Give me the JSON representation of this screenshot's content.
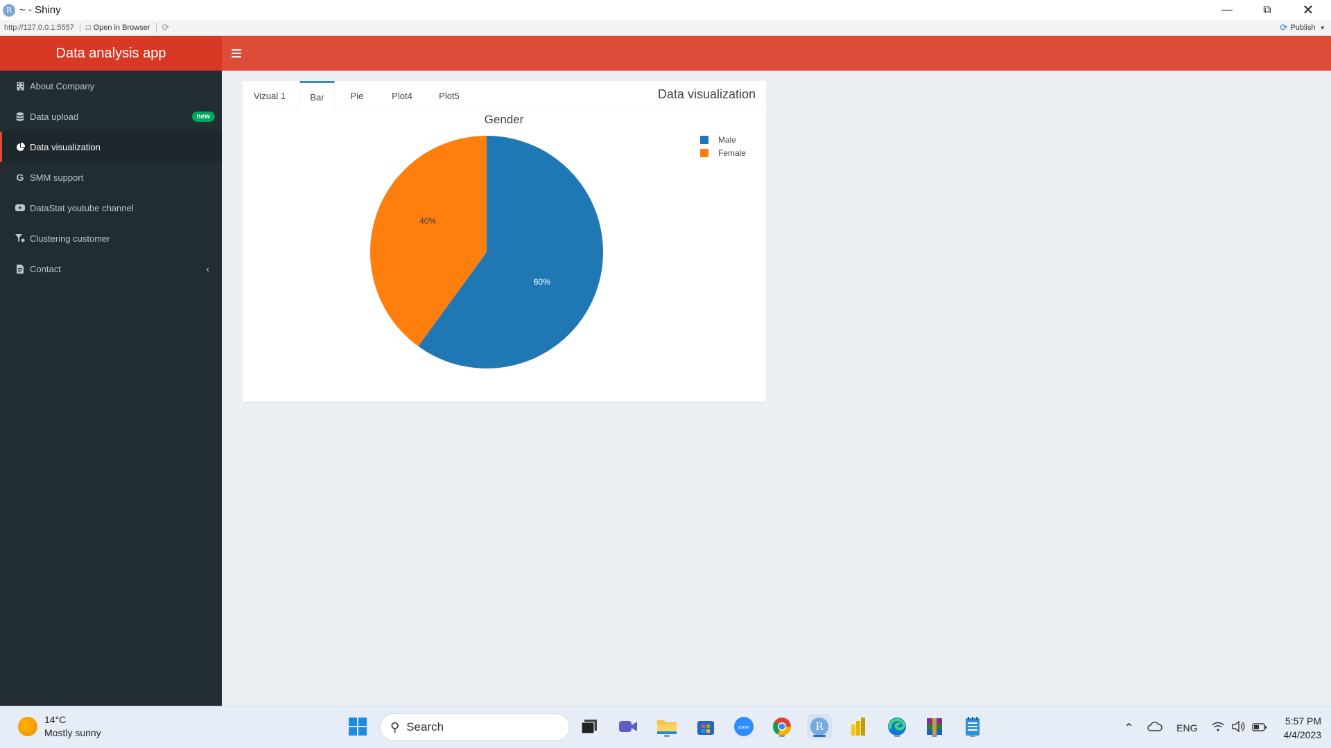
{
  "window": {
    "title": "~ - Shiny",
    "r_logo": "R"
  },
  "addressbar": {
    "url": "http://127.0.0.1:5557",
    "open_in_browser": "Open in Browser",
    "publish": "Publish"
  },
  "app": {
    "logo": "Data analysis app"
  },
  "sidebar": {
    "items": [
      {
        "label": "About Company",
        "icon": "building-icon"
      },
      {
        "label": "Data upload",
        "icon": "database-icon",
        "badge": "new"
      },
      {
        "label": "Data visualization",
        "icon": "pie-chart-icon",
        "active": true
      },
      {
        "label": "SMM support",
        "icon": "google-icon"
      },
      {
        "label": "DataStat youtube channel",
        "icon": "youtube-icon"
      },
      {
        "label": "Clustering customer",
        "icon": "filter-icon"
      },
      {
        "label": "Contact",
        "icon": "document-icon"
      }
    ]
  },
  "box": {
    "title": "Data visualization",
    "tabs": [
      "Vizual 1",
      "Bar",
      "Pie",
      "Plot4",
      "Plot5"
    ],
    "active_tab": "Bar"
  },
  "chart_data": {
    "type": "pie",
    "title": "Gender",
    "categories": [
      "Male",
      "Female"
    ],
    "values": [
      60,
      40
    ],
    "labels": [
      "60%",
      "40%"
    ],
    "colors": [
      "#1f77b4",
      "#ff7f0e"
    ],
    "legend": "top-right"
  },
  "taskbar": {
    "weather_temp": "14°C",
    "weather_desc": "Mostly sunny",
    "search_placeholder": "Search",
    "lang": "ENG",
    "time": "5:57 PM",
    "date": "4/4/2023",
    "apps": [
      "windows-start-icon",
      "search-icon",
      "task-view-icon",
      "teams-icon",
      "file-explorer-icon",
      "store-icon",
      "zoom-icon",
      "chrome-icon",
      "rstudio-icon",
      "powerbi-icon",
      "edge-icon",
      "winrar-icon",
      "notepad-icon"
    ]
  }
}
